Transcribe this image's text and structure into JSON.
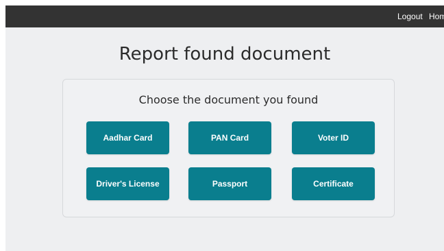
{
  "navbar": {
    "logout_label": "Logout",
    "home_label": "Home"
  },
  "page": {
    "title": "Report found document"
  },
  "card": {
    "title": "Choose the document you found",
    "buttons": [
      "Aadhar Card",
      "PAN Card",
      "Voter ID",
      "Driver's License",
      "Passport",
      "Certificate"
    ]
  },
  "colors": {
    "navbar_bg": "#333333",
    "page_bg": "#eeeff1",
    "button_bg": "#0a7e8e",
    "button_text": "#ffffff"
  }
}
